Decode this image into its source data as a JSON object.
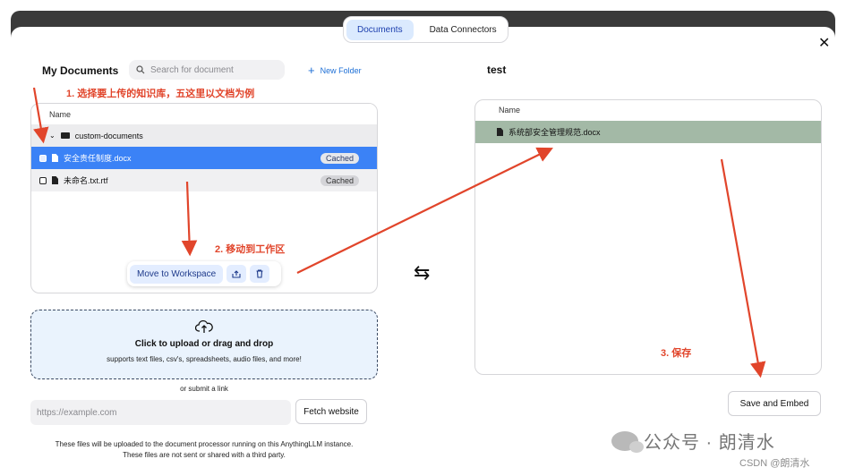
{
  "tabs": [
    {
      "label": "Documents",
      "active": true
    },
    {
      "label": "Data Connectors",
      "active": false
    }
  ],
  "left": {
    "title": "My Documents",
    "search_placeholder": "Search for document",
    "new_folder": "New Folder",
    "column_name": "Name",
    "folder": "custom-documents",
    "files": [
      {
        "name": "安全责任制度.docx",
        "badge": "Cached",
        "selected": true
      },
      {
        "name": "未命名.txt.rtf",
        "badge": "Cached",
        "selected": false
      }
    ],
    "move_button": "Move to Workspace"
  },
  "right": {
    "title": "test",
    "column_name": "Name",
    "files": [
      {
        "name": "系统部安全管理规范.docx"
      }
    ],
    "save_button": "Save and Embed"
  },
  "upload": {
    "main": "Click to upload or drag and drop",
    "sub": "supports text files, csv's, spreadsheets, audio files, and more!",
    "submit_link": "or submit a link",
    "url_placeholder": "https://example.com",
    "fetch_button": "Fetch website",
    "disclaimer_1": "These files will be uploaded to the document processor running on this AnythingLLM instance.",
    "disclaimer_2": "These files are not sent or shared with a third party."
  },
  "annotations": {
    "step1": "1. 选择要上传的知识库，五这里以文档为例",
    "step2": "2. 移动到工作区",
    "step3": "3. 保存",
    "color": "#e1452b"
  },
  "watermark": {
    "text": "公众号 · 朗清水",
    "csdn": "CSDN @朗清水"
  },
  "colors": {
    "accent": "#3b82f6",
    "selected_right": "#a3b9a6",
    "tab_active": "#dbeafe"
  },
  "icons": [
    "search-icon",
    "plus-icon",
    "close-icon",
    "chevron-down-icon",
    "folder-icon",
    "file-icon",
    "upload-cloud-icon",
    "swap-icon",
    "trash-icon",
    "upload-to-workspace-icon"
  ]
}
